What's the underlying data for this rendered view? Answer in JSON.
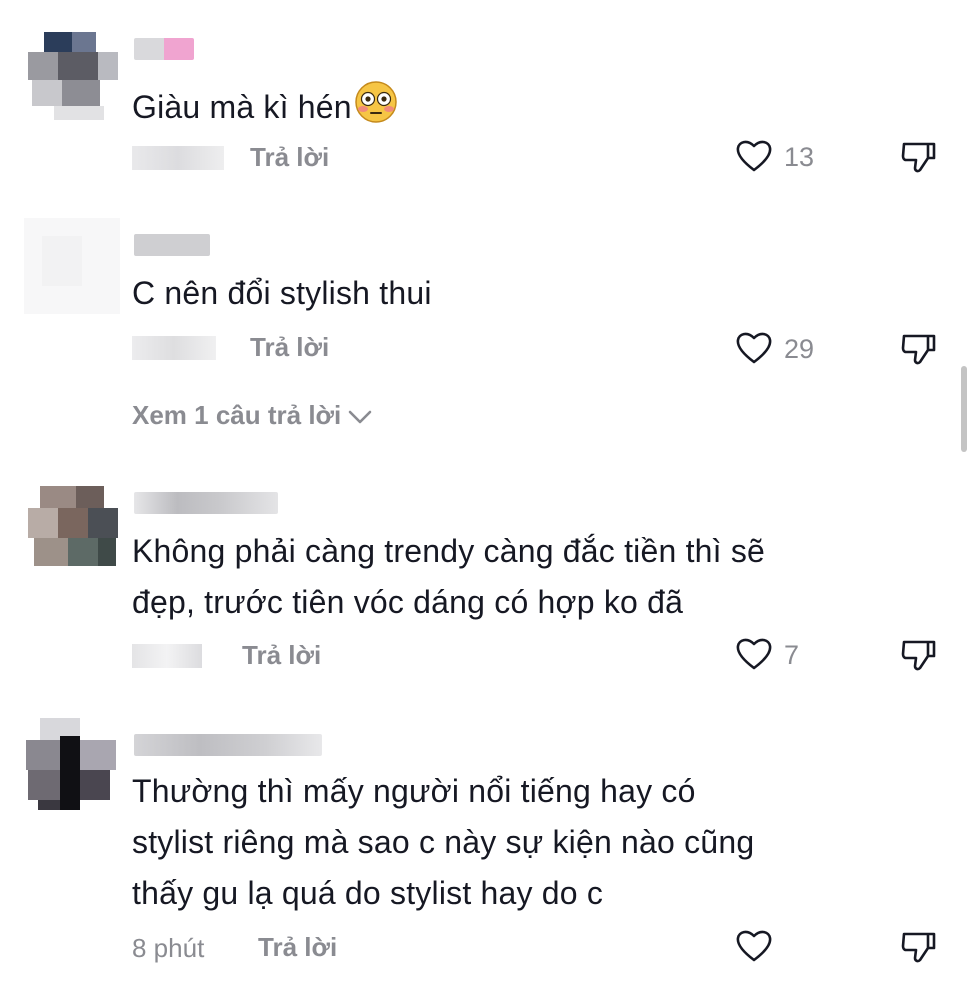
{
  "comments": [
    {
      "text": "Giàu mà kì hén",
      "emoji": "flushed-face-emoji",
      "time": "",
      "reply_label": "Trả lời",
      "likes": "13"
    },
    {
      "text": "C nên đổi stylish thui",
      "time": "",
      "reply_label": "Trả lời",
      "likes": "29",
      "view_replies_label": "Xem 1 câu trả lời"
    },
    {
      "text_lines": [
        "Không phải càng trendy càng đắc tiền thì sẽ",
        "đẹp, trước tiên vóc dáng có hợp ko đã"
      ],
      "time": "",
      "reply_label": "Trả lời",
      "likes": "7"
    },
    {
      "text_lines": [
        "Thường thì mấy người nổi tiếng hay có",
        "stylist riêng mà sao c này sự kiện nào cũng",
        "thấy gu lạ quá do stylist hay do c"
      ],
      "time": "8 phút",
      "reply_label": "Trả lời",
      "likes": ""
    }
  ],
  "icons": {
    "like": "heart-outline-icon",
    "dislike": "thumbs-down-icon",
    "expand": "chevron-down-icon"
  },
  "colors": {
    "text": "#161823",
    "secondary": "#8a8b91",
    "background": "#ffffff"
  }
}
